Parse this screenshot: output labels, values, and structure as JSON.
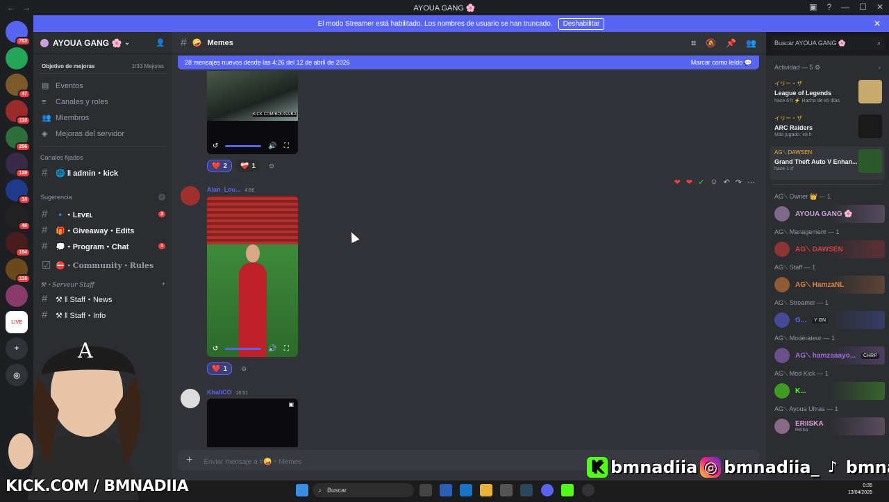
{
  "window": {
    "title": "AYOUA GANG 🌸"
  },
  "guilds": [
    {
      "label": "",
      "badge": "703",
      "color": "#5865f2"
    },
    {
      "label": "",
      "badge": "",
      "color": "#23a55a"
    },
    {
      "label": "",
      "badge": "47",
      "color": "#7b5a2a"
    },
    {
      "label": "",
      "badge": "110",
      "color": "#9b2b2b"
    },
    {
      "label": "",
      "badge": "256",
      "color": "#2e6e3a"
    },
    {
      "label": "",
      "badge": "128",
      "color": "#3a2a4a"
    },
    {
      "label": "",
      "badge": "16",
      "color": "#1f3a8a"
    },
    {
      "label": "",
      "badge": "48",
      "color": "#222222"
    },
    {
      "label": "",
      "badge": "104",
      "color": "#4a1c1c"
    },
    {
      "label": "",
      "badge": "116",
      "color": "#6a4a1a"
    },
    {
      "label": "",
      "badge": "",
      "color": "#8a3a6a"
    },
    {
      "label": "LIVE",
      "badge": "",
      "color": "#ffffff"
    }
  ],
  "streamer_banner": {
    "text": "El modo Streamer está habilitado. Los nombres de usuario se han truncado.",
    "button": "Deshabilitar"
  },
  "server": {
    "name": "AYOUA GANG 🌸",
    "boost_goal": "Objetivo de mejoras",
    "boost_count": "1/33 Mejoras",
    "menu": [
      "Eventos",
      "Canales y roles",
      "Miembros",
      "Mejoras del servidor"
    ],
    "pinned_label": "Canales fijados",
    "pinned_channel": "🌐 ‖ admin・kick",
    "suggest_label": "Sugerencia",
    "channels": [
      {
        "name": "🔹・Lᴇᴠᴇʟ",
        "unread": "2"
      },
      {
        "name": "🎁・Giveaway・Edits",
        "unread": ""
      },
      {
        "name": "💭・Program・Chat",
        "unread": "1"
      }
    ],
    "rules": "⛔・Community・Rules",
    "staff_category": "⚒・Serveur Staff",
    "staff_channels": [
      "⚒ ‖ Staff・News",
      "⚒ ‖ Staff・Info"
    ]
  },
  "channel": {
    "name": "Memes",
    "new_messages": "28 mensajes nuevos desde las 4:26 del 12 de abril de 2026",
    "mark_read": "Marcar como leído",
    "composer_placeholder": "Enviar mensaje a #🤪・Memes"
  },
  "messages": [
    {
      "author": "",
      "time": "",
      "reactions": [
        {
          "emoji": "❤️",
          "count": "2",
          "on": true
        },
        {
          "emoji": "❤️‍🩹",
          "count": "1",
          "on": false
        }
      ]
    },
    {
      "author": "Alan_Lou...",
      "time": "4:56",
      "reactions": [
        {
          "emoji": "❤️",
          "count": "1",
          "on": true
        }
      ]
    },
    {
      "author": "KhaliCO",
      "time": "16:51",
      "reactions": []
    }
  ],
  "media_overlay": "KICK.COM/BOUGAIBA",
  "search_placeholder": "Buscar AYOUA GANG 🌸",
  "activity": {
    "title": "Actividad — 5 ⚙",
    "items": [
      {
        "user": "イリー・ザ",
        "game": "League of Legends",
        "meta": "hace 6 h   ⚡ Racha de x6 días",
        "cover_color": "#c8aa6e"
      },
      {
        "user": "イリー・ザ",
        "game": "ARC Raiders",
        "meta": "Más jugado: 48 h",
        "cover_color": "#1a1a1a"
      },
      {
        "user": "AG⟍ DAWSEN",
        "game": "Grand Theft Auto V Enhan...",
        "meta": "hace 1 d",
        "cover_color": "#2d5a2d"
      }
    ]
  },
  "roles": [
    {
      "title": "AG⟍ Owner 👑 — 1",
      "member": "AYOUA GANG 🌸",
      "color": "#c9a0dc",
      "tag": ""
    },
    {
      "title": "AG⟍ Management — 1",
      "member": "AG⟍ DAWSEN",
      "color": "#e33b3b",
      "tag": ""
    },
    {
      "title": "AG⟍ Staff — 1",
      "member": "AG⟍ HamzaNL",
      "color": "#e8823b",
      "tag": ""
    },
    {
      "title": "AG⟍ Streamer — 1",
      "member": "G...",
      "color": "#5865f2",
      "tag": "Y GN"
    },
    {
      "title": "AG⟍ Modérateur — 1",
      "member": "AG⟍ hamzaaayo...",
      "color": "#a56be0",
      "tag": "CHRP"
    },
    {
      "title": "AG⟍ Mod Kick — 1",
      "member": "K...",
      "color": "#53fc18",
      "tag": ""
    },
    {
      "title": "AG⟍ Ayoua Ultras — 1",
      "member": "ERIISKA",
      "color": "#e0a0d8",
      "tag": ""
    }
  ],
  "member_sub": "Reina",
  "taskbar": {
    "search": "Buscar",
    "time": "0:35",
    "date": "13/04/2026"
  },
  "overlay": {
    "kick_url": "KICK.COM / BMNADIIA",
    "handle1": "bmnadiia",
    "handle2": "bmnadiia_",
    "handle3": "bmnadiia"
  }
}
